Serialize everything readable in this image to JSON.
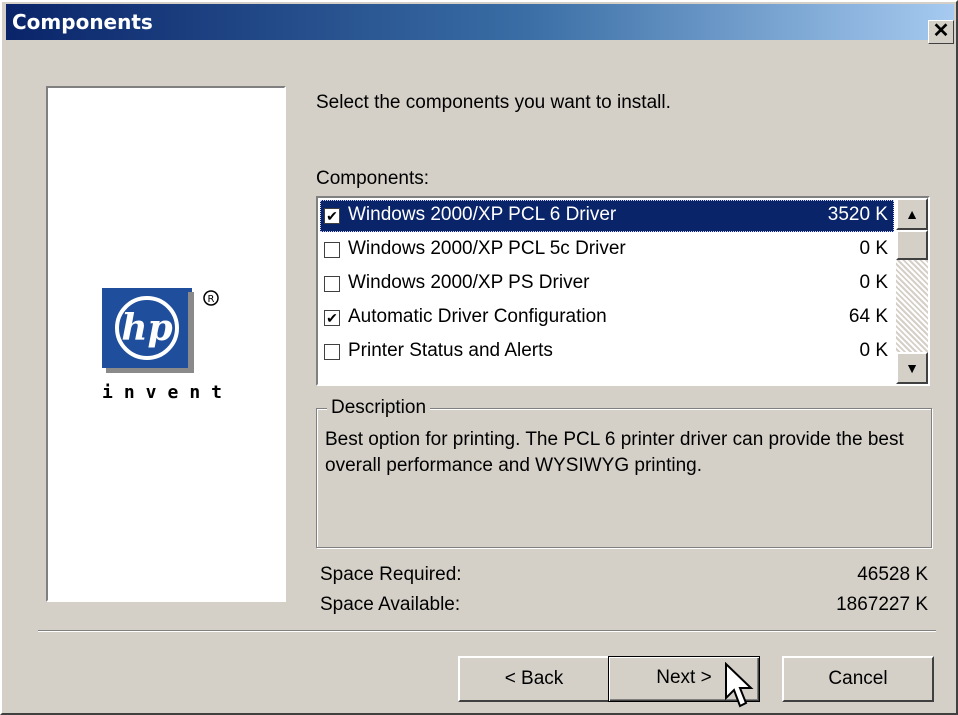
{
  "window": {
    "title": "Components"
  },
  "instruction": "Select the components you want to install.",
  "components_label": "Components:",
  "components": [
    {
      "label": "Windows 2000/XP PCL 6 Driver",
      "size": "3520 K",
      "checked": true,
      "selected": true
    },
    {
      "label": "Windows 2000/XP PCL 5c Driver",
      "size": "0 K",
      "checked": false,
      "selected": false
    },
    {
      "label": "Windows 2000/XP PS Driver",
      "size": "0 K",
      "checked": false,
      "selected": false
    },
    {
      "label": "Automatic Driver Configuration",
      "size": "64 K",
      "checked": true,
      "selected": false
    },
    {
      "label": "Printer Status and Alerts",
      "size": "0 K",
      "checked": false,
      "selected": false
    }
  ],
  "description": {
    "legend": "Description",
    "text": "Best option for printing.  The PCL 6 printer driver can provide the best overall performance and WYSIWYG printing."
  },
  "space": {
    "required_label": "Space Required:",
    "required_value": "46528 K",
    "available_label": "Space Available:",
    "available_value": "1867227 K"
  },
  "buttons": {
    "back": "< Back",
    "next": "Next >",
    "cancel": "Cancel"
  },
  "logo": {
    "brand": "hp",
    "tagline": "invent",
    "registered": "®"
  },
  "icons": {
    "close": "close-icon",
    "scroll_up": "scroll-up-icon",
    "scroll_down": "scroll-down-icon",
    "cursor": "mouse-pointer-icon"
  },
  "colors": {
    "title_start": "#0a246a",
    "title_end": "#a6caf0",
    "selection": "#0a246a",
    "face": "#d4d0c8",
    "hp_blue": "#1f4e9c"
  }
}
